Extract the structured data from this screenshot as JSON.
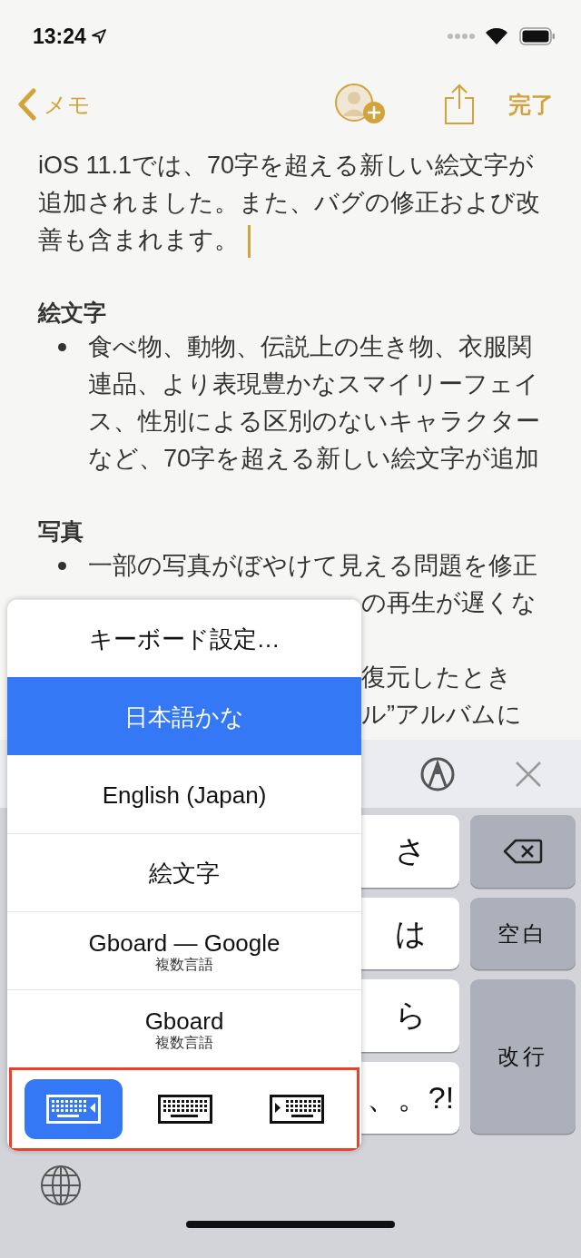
{
  "status_bar": {
    "time": "13:24"
  },
  "nav": {
    "back": "メモ",
    "done": "完了"
  },
  "note": {
    "intro": "iOS 11.1では、70字を超える新しい絵文字が追加されました。また、バグの修正および改善も含まれます。",
    "sections": [
      {
        "heading": "絵文字",
        "bullets": [
          "食べ物、動物、伝説上の生き物、衣服関連品、より表現豊かなスマイリーフェイス、性別による区別のないキャラクターなど、70字を超える新しい絵文字が追加"
        ]
      },
      {
        "heading": "写真",
        "bullets": [
          "一部の写真がぼやけて見える問題を修正"
        ],
        "covered_lines": [
          [
            "の再生が遅くな"
          ],
          [
            "復元したとき",
            "ル”アルバムに"
          ]
        ]
      }
    ]
  },
  "keyboard_menu": {
    "items": [
      {
        "label": "キーボード設定…",
        "selected": false
      },
      {
        "label": "日本語かな",
        "selected": true
      },
      {
        "label": "English (Japan)",
        "selected": false
      },
      {
        "label": "絵文字",
        "selected": false
      },
      {
        "label": "Gboard — Google",
        "sublabel": "複数言語",
        "selected": false
      },
      {
        "label": "Gboard",
        "sublabel": "複数言語",
        "selected": false
      }
    ],
    "modes": [
      {
        "kind": "left",
        "selected": true
      },
      {
        "kind": "full",
        "selected": false
      },
      {
        "kind": "right",
        "selected": false
      }
    ],
    "modes_highlighted": true
  },
  "keyboard": {
    "keys": [
      "さ",
      "は",
      "ら",
      "、。?!"
    ],
    "space": "空白",
    "return": "改行"
  }
}
